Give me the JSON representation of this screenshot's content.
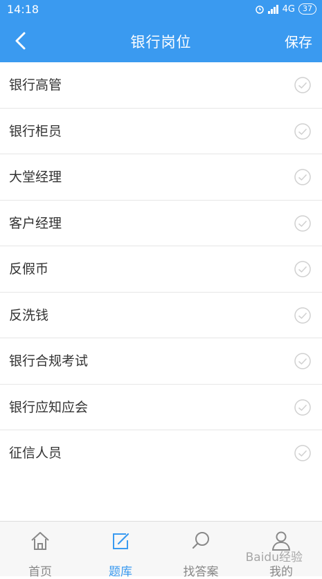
{
  "status_bar": {
    "time": "14:18",
    "network": "4G",
    "battery": "37"
  },
  "navbar": {
    "title": "银行岗位",
    "save_label": "保存"
  },
  "list": {
    "items": [
      {
        "label": "银行高管"
      },
      {
        "label": "银行柜员"
      },
      {
        "label": "大堂经理"
      },
      {
        "label": "客户经理"
      },
      {
        "label": "反假币"
      },
      {
        "label": "反洗钱"
      },
      {
        "label": "银行合规考试"
      },
      {
        "label": "银行应知应会"
      },
      {
        "label": "征信人员"
      }
    ]
  },
  "tabbar": {
    "tabs": [
      {
        "label": "首页",
        "icon": "home-icon"
      },
      {
        "label": "题库",
        "icon": "edit-icon"
      },
      {
        "label": "找答案",
        "icon": "search-icon"
      },
      {
        "label": "我的",
        "icon": "user-icon"
      }
    ],
    "active_index": 1
  },
  "colors": {
    "primary": "#3a9af0",
    "check": "#d0d0d0",
    "tab_inactive": "#888888"
  },
  "watermark": "Baidu经验"
}
